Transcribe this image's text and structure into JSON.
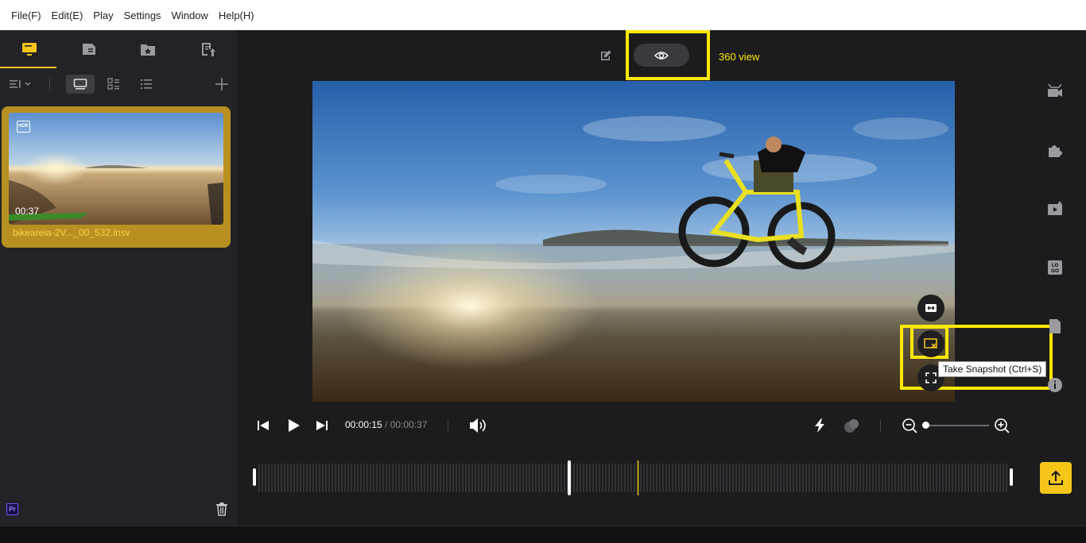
{
  "menu": {
    "file": "File(F)",
    "edit": "Edit(E)",
    "play": "Play",
    "settings": "Settings",
    "window": "Window",
    "help": "Help(H)"
  },
  "media": {
    "duration": "00:37",
    "filename": "bikeareia-2V..._00_532.insv",
    "hdr_badge": "HDR"
  },
  "badges": {
    "premiere": "Pr"
  },
  "preview": {
    "view_label": "360 view",
    "snapshot_tooltip": "Take Snapshot (Ctrl+S)"
  },
  "playback": {
    "current_time": "00:00:15",
    "separator": " / ",
    "total_time": "00:00:37",
    "zoom_level": 0.0,
    "playhead_fraction": 0.505
  },
  "colors": {
    "accent": "#f5c518",
    "highlight": "#ffe800"
  },
  "icons": {
    "left_tabs": [
      "monitor-icon",
      "media-icon",
      "favorites-folder-icon",
      "export-list-icon"
    ],
    "right_rail": [
      "camera-icon",
      "plugin-icon",
      "ai-video-icon",
      "logo-icon",
      "document-icon",
      "info-icon"
    ]
  }
}
